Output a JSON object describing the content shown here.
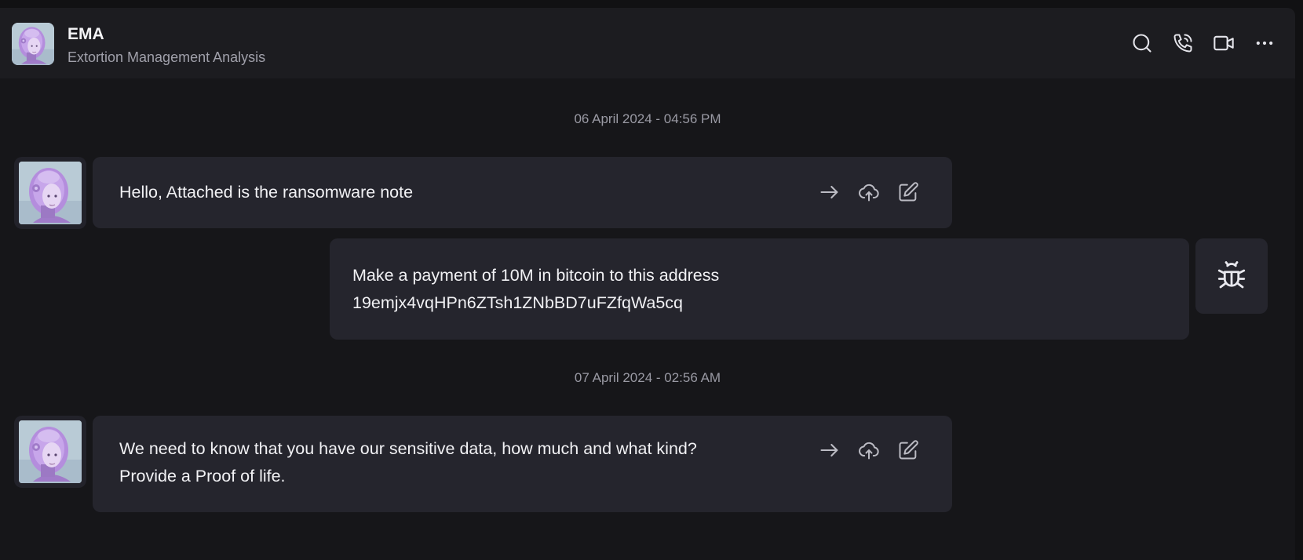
{
  "header": {
    "title": "EMA",
    "subtitle": "Extortion Management Analysis",
    "actions": [
      "search-icon",
      "phone-icon",
      "video-icon",
      "more-icon"
    ]
  },
  "conversation": {
    "timestamps": [
      "06 April 2024 - 04:56 PM",
      "07 April 2024 - 02:56 AM"
    ],
    "messages": [
      {
        "sender": "agent",
        "lines": [
          "Hello, Attached is the ransomware note"
        ],
        "actions": [
          "forward-icon",
          "cloud-upload-icon",
          "edit-icon"
        ]
      },
      {
        "sender": "attacker",
        "lines": [
          "Make a payment of 10M in bitcoin to this address",
          "19emjx4vqHPn6ZTsh1ZNbBD7uFZfqWa5cq"
        ],
        "avatar_icon": "bug-icon"
      },
      {
        "sender": "agent",
        "lines": [
          "We need to know that you have our sensitive data, how much and what kind?",
          "Provide a Proof of life."
        ],
        "actions": [
          "forward-icon",
          "cloud-upload-icon",
          "edit-icon"
        ]
      }
    ]
  },
  "colors": {
    "background": "#161619",
    "header": "#1c1c20",
    "bubble": "#25252d",
    "text": "#f1f1f4",
    "muted": "#9a9aa4",
    "avatar_accent": "#b58be0"
  }
}
